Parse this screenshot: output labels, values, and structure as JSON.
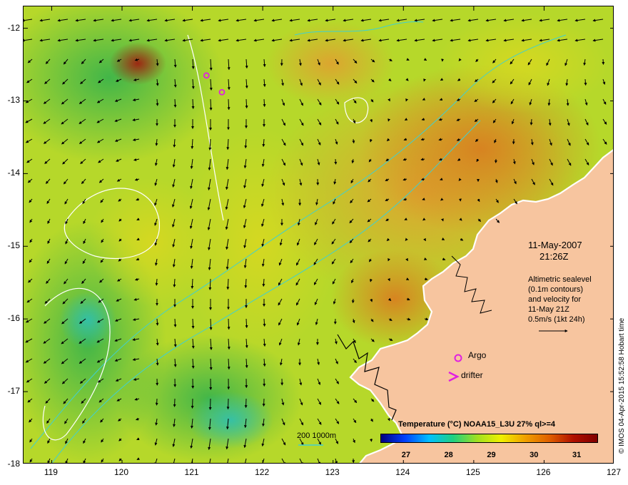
{
  "map": {
    "lon_range": [
      118.6,
      127.0
    ],
    "lat_range": [
      -18.0,
      -11.7
    ],
    "y_ticks": [
      {
        "value": -12,
        "label": "-12"
      },
      {
        "value": -13,
        "label": "-13"
      },
      {
        "value": -14,
        "label": "-14"
      },
      {
        "value": -15,
        "label": "-15"
      },
      {
        "value": -16,
        "label": "-16"
      },
      {
        "value": -17,
        "label": "-17"
      },
      {
        "value": -18,
        "label": "-18"
      }
    ],
    "x_ticks": [
      {
        "value": 119,
        "label": "119"
      },
      {
        "value": 120,
        "label": "120"
      },
      {
        "value": 121,
        "label": "121"
      },
      {
        "value": 122,
        "label": "122"
      },
      {
        "value": 123,
        "label": "123"
      },
      {
        "value": 124,
        "label": "124"
      },
      {
        "value": 125,
        "label": "125"
      },
      {
        "value": 126,
        "label": "126"
      },
      {
        "value": 127,
        "label": "127"
      }
    ],
    "colors": {
      "land": "#f7c59f",
      "contour": "#ffffff",
      "bathymetry": "#40d0d0",
      "argo": "#e020e0",
      "arrow": "#000000"
    },
    "argo_floats": [
      {
        "lon": 121.2,
        "lat": -12.65
      },
      {
        "lon": 121.42,
        "lat": -12.88
      }
    ]
  },
  "annotations": {
    "date": "11-May-2007",
    "time": "21:26Z",
    "altimetry_lines": [
      "Altimetric sealevel",
      "(0.1m contours)",
      "and velocity for",
      "11-May 21Z",
      "0.5m/s (1kt 24h)"
    ],
    "argo_label": "Argo",
    "drifter_label": "drifter",
    "scale_label": "200  1000m",
    "credit": "© IMOS 04-Apr-2015 15:52:58 Hobart time"
  },
  "colorbar": {
    "title": "Temperature (°C) NOAA15_L3U 27% ql>=4",
    "range": [
      26.4,
      31.5
    ],
    "ticks": [
      {
        "value": 27,
        "label": "27"
      },
      {
        "value": 28,
        "label": "28"
      },
      {
        "value": 29,
        "label": "29"
      },
      {
        "value": 30,
        "label": "30"
      },
      {
        "value": 31,
        "label": "31"
      }
    ],
    "colors": [
      "#000080",
      "#0040ff",
      "#00c0ff",
      "#20d080",
      "#a0e020",
      "#f0f000",
      "#f0a000",
      "#e06000",
      "#b01000",
      "#800000"
    ]
  }
}
